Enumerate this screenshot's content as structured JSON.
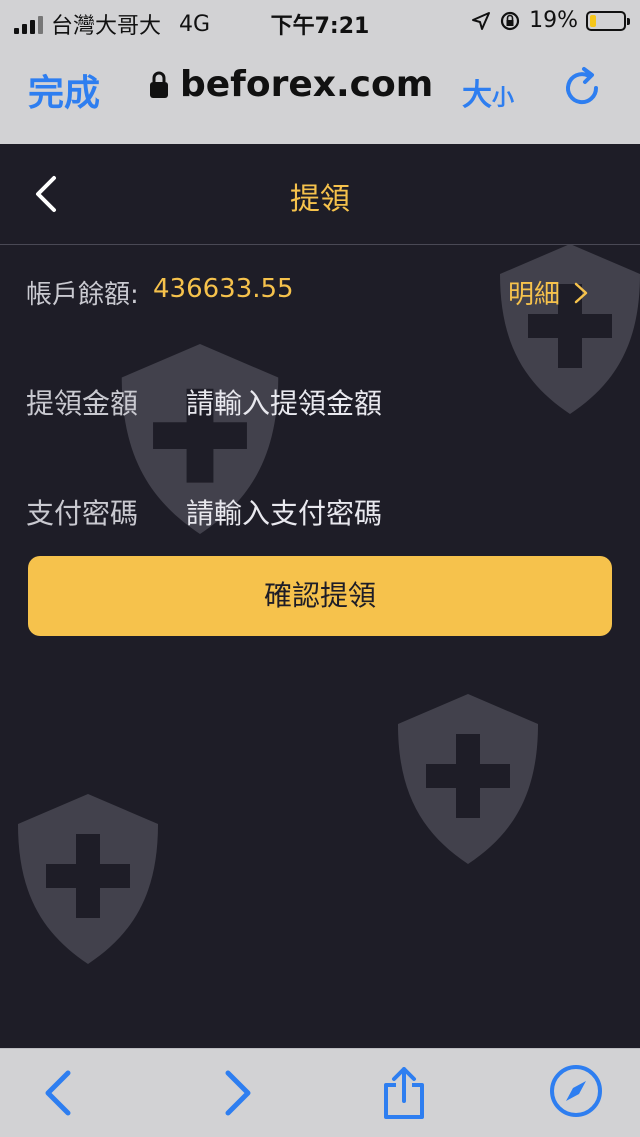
{
  "status_bar": {
    "carrier": "台灣大哥大",
    "network": "4G",
    "time": "下午7:21",
    "battery_percent": "19%",
    "battery_level": 0.19
  },
  "browser": {
    "done_label": "完成",
    "url": "beforex.com",
    "text_size_big": "大",
    "text_size_small": "小"
  },
  "page": {
    "title": "提領",
    "balance_label": "帳戶餘額:",
    "balance_value": "436633.55",
    "detail_label": "明細",
    "amount_label": "提領金額",
    "amount_placeholder": "請輸入提領金額",
    "password_label": "支付密碼",
    "password_placeholder": "請輸入支付密碼",
    "confirm_label": "確認提領"
  },
  "colors": {
    "accent": "#f6c24c",
    "background": "#1e1d27",
    "link_blue": "#2e7ef0"
  },
  "icons": [
    "lock-icon",
    "reload-icon",
    "back-arrow-icon",
    "chevron-right-icon",
    "shield-icon",
    "browser-back-icon",
    "browser-forward-icon",
    "share-icon",
    "compass-icon"
  ]
}
